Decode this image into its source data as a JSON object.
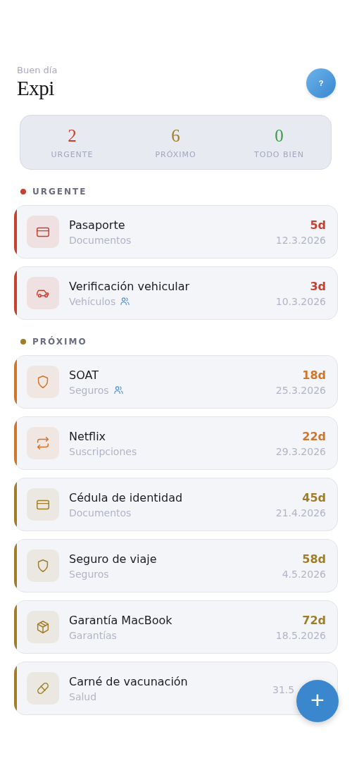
{
  "header": {
    "greeting": "Buen día",
    "title": "Expi",
    "help_button": "?"
  },
  "summary": [
    {
      "count": "2",
      "label": "URGENTE",
      "color": "#c8402e"
    },
    {
      "count": "6",
      "label": "PRÓXIMO",
      "color": "#a07e28"
    },
    {
      "count": "0",
      "label": "TODO BIEN",
      "color": "#3f9a4c"
    }
  ],
  "sections": [
    {
      "title": "URGENTE",
      "color": "#c8402e",
      "items": [
        {
          "name": "Pasaporte",
          "category": "Documentos",
          "kind": "card",
          "shared": false,
          "days": "5d",
          "date": "12.3.2026",
          "color": "#c8402e"
        },
        {
          "name": "Verificación vehicular",
          "category": "Vehículos",
          "kind": "car",
          "shared": true,
          "days": "3d",
          "date": "10.3.2026",
          "color": "#c8402e"
        }
      ]
    },
    {
      "title": "PRÓXIMO",
      "color": "#a07e28",
      "items": [
        {
          "name": "SOAT",
          "category": "Seguros",
          "kind": "shield",
          "shared": true,
          "days": "18d",
          "date": "25.3.2026",
          "color": "#d0762c"
        },
        {
          "name": "Netflix",
          "category": "Suscripciones",
          "kind": "repeat",
          "shared": false,
          "days": "22d",
          "date": "29.3.2026",
          "color": "#d0762c"
        },
        {
          "name": "Cédula de identidad",
          "category": "Documentos",
          "kind": "card",
          "shared": false,
          "days": "45d",
          "date": "21.4.2026",
          "color": "#a07e28"
        },
        {
          "name": "Seguro de viaje",
          "category": "Seguros",
          "kind": "shield",
          "shared": false,
          "days": "58d",
          "date": "4.5.2026",
          "color": "#a07e28"
        },
        {
          "name": "Garantía MacBook",
          "category": "Garantías",
          "kind": "box",
          "shared": false,
          "days": "72d",
          "date": "18.5.2026",
          "color": "#a07e28"
        },
        {
          "name": "Carné de vacunación",
          "category": "Salud",
          "kind": "pill",
          "shared": false,
          "date": "31.5",
          "color": "#a07e28"
        }
      ]
    }
  ],
  "add_button": "+"
}
